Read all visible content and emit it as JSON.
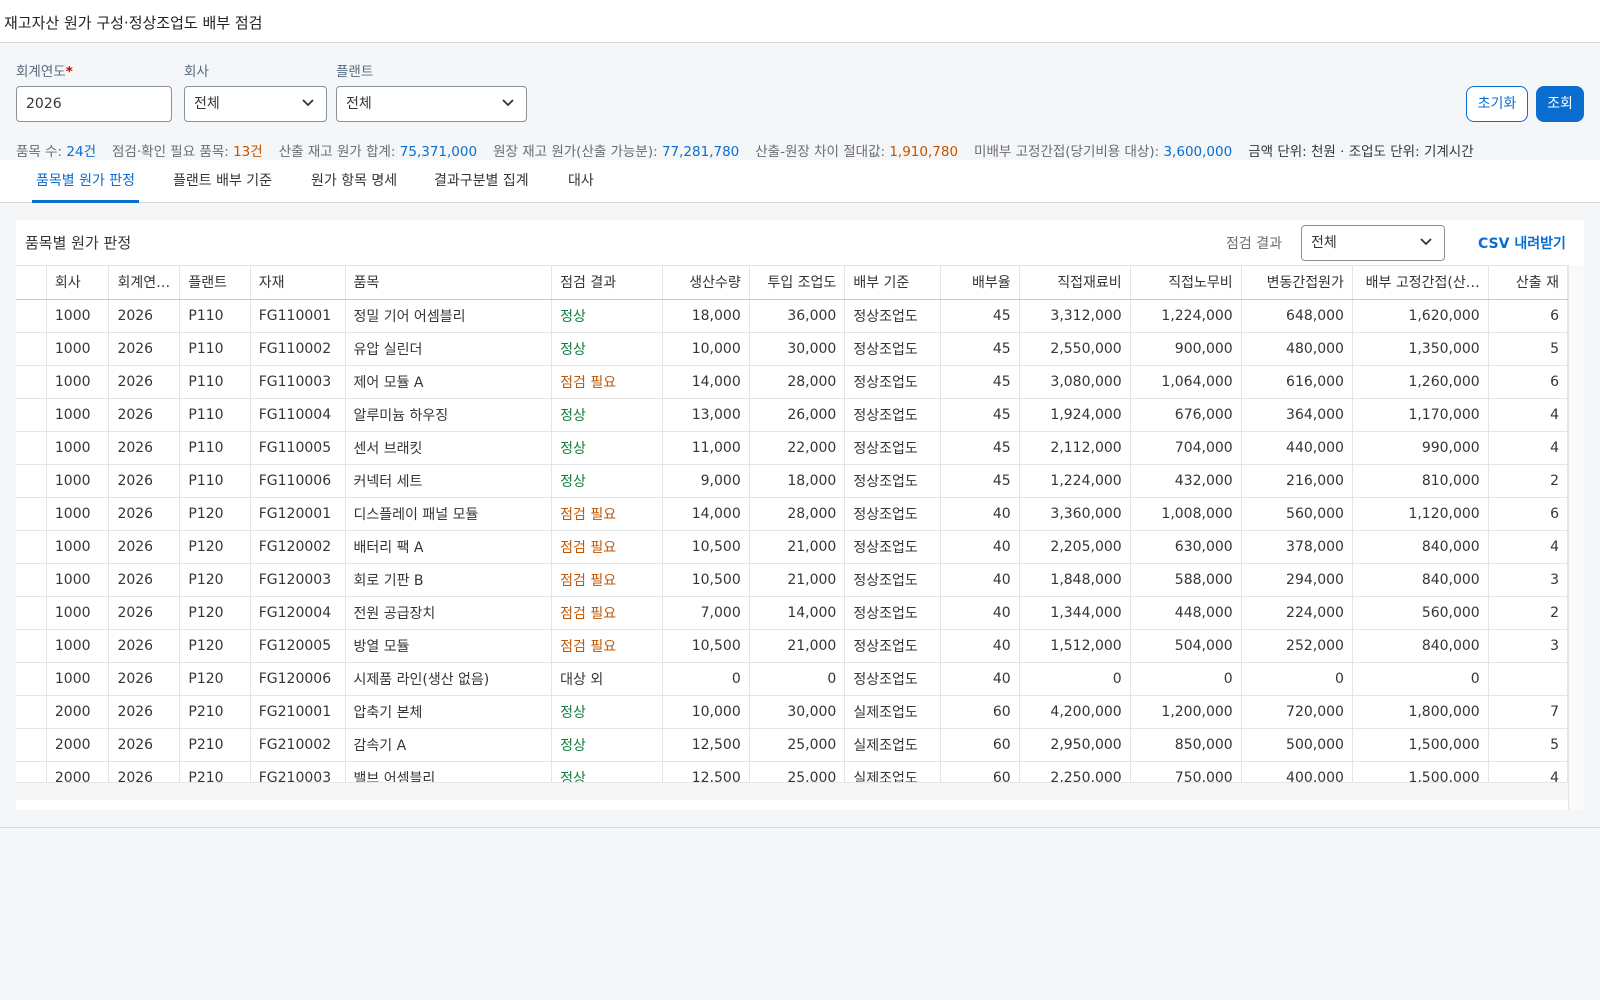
{
  "app": {
    "title": "재고자산 원가 구성·정상조업도 배부 점검"
  },
  "filters": {
    "year_label": "회계연도",
    "year_required": "*",
    "year_value": "2026",
    "company_label": "회사",
    "company_value": "전체",
    "plant_label": "플랜트",
    "plant_value": "전체",
    "reset_label": "초기화",
    "search_label": "조회"
  },
  "summary": {
    "items_label": "품목 수: ",
    "items_value": "24건",
    "check_label": "점검·확인 필요 품목: ",
    "check_value": "13건",
    "calc_label": "산출 재고 원가 합계: ",
    "calc_value": "75,371,000",
    "ledger_label": "원장 재고 원가(산출 가능분): ",
    "ledger_value": "77,281,780",
    "diff_label": "산출-원장 차이 절대값: ",
    "diff_value": "1,910,780",
    "unalloc_label": "미배부 고정간접(당기비용 대상): ",
    "unalloc_value": "3,600,000",
    "unit_text": "금액 단위: 천원 · 조업도 단위: 기계시간"
  },
  "tabs": [
    {
      "label": "품목별 원가 판정",
      "active": true
    },
    {
      "label": "플랜트 배부 기준",
      "active": false
    },
    {
      "label": "원가 항목 명세",
      "active": false
    },
    {
      "label": "결과구분별 집계",
      "active": false
    },
    {
      "label": "대사",
      "active": false
    }
  ],
  "panel": {
    "title": "품목별 원가 판정",
    "result_filter_label": "점검 결과",
    "result_filter_value": "전체",
    "csv_label": "CSV 내려받기"
  },
  "table": {
    "columns": [
      "회사",
      "회계연…",
      "플랜트",
      "자재",
      "품목",
      "점검 결과",
      "생산수량",
      "투입 조업도",
      "배부 기준",
      "배부율",
      "직접재료비",
      "직접노무비",
      "변동간접원가",
      "배부 고정간접(산…",
      "산출 재"
    ],
    "rows": [
      [
        "1000",
        "2026",
        "P110",
        "FG110001",
        "정밀 기어 어셈블리",
        "정상",
        "18,000",
        "36,000",
        "정상조업도",
        "45",
        "3,312,000",
        "1,224,000",
        "648,000",
        "1,620,000",
        "6"
      ],
      [
        "1000",
        "2026",
        "P110",
        "FG110002",
        "유압 실린더",
        "정상",
        "10,000",
        "30,000",
        "정상조업도",
        "45",
        "2,550,000",
        "900,000",
        "480,000",
        "1,350,000",
        "5"
      ],
      [
        "1000",
        "2026",
        "P110",
        "FG110003",
        "제어 모듈 A",
        "점검 필요",
        "14,000",
        "28,000",
        "정상조업도",
        "45",
        "3,080,000",
        "1,064,000",
        "616,000",
        "1,260,000",
        "6"
      ],
      [
        "1000",
        "2026",
        "P110",
        "FG110004",
        "알루미늄 하우징",
        "정상",
        "13,000",
        "26,000",
        "정상조업도",
        "45",
        "1,924,000",
        "676,000",
        "364,000",
        "1,170,000",
        "4"
      ],
      [
        "1000",
        "2026",
        "P110",
        "FG110005",
        "센서 브래킷",
        "정상",
        "11,000",
        "22,000",
        "정상조업도",
        "45",
        "2,112,000",
        "704,000",
        "440,000",
        "990,000",
        "4"
      ],
      [
        "1000",
        "2026",
        "P110",
        "FG110006",
        "커넥터 세트",
        "정상",
        "9,000",
        "18,000",
        "정상조업도",
        "45",
        "1,224,000",
        "432,000",
        "216,000",
        "810,000",
        "2"
      ],
      [
        "1000",
        "2026",
        "P120",
        "FG120001",
        "디스플레이 패널 모듈",
        "점검 필요",
        "14,000",
        "28,000",
        "정상조업도",
        "40",
        "3,360,000",
        "1,008,000",
        "560,000",
        "1,120,000",
        "6"
      ],
      [
        "1000",
        "2026",
        "P120",
        "FG120002",
        "배터리 팩 A",
        "점검 필요",
        "10,500",
        "21,000",
        "정상조업도",
        "40",
        "2,205,000",
        "630,000",
        "378,000",
        "840,000",
        "4"
      ],
      [
        "1000",
        "2026",
        "P120",
        "FG120003",
        "회로 기판 B",
        "점검 필요",
        "10,500",
        "21,000",
        "정상조업도",
        "40",
        "1,848,000",
        "588,000",
        "294,000",
        "840,000",
        "3"
      ],
      [
        "1000",
        "2026",
        "P120",
        "FG120004",
        "전원 공급장치",
        "점검 필요",
        "7,000",
        "14,000",
        "정상조업도",
        "40",
        "1,344,000",
        "448,000",
        "224,000",
        "560,000",
        "2"
      ],
      [
        "1000",
        "2026",
        "P120",
        "FG120005",
        "방열 모듈",
        "점검 필요",
        "10,500",
        "21,000",
        "정상조업도",
        "40",
        "1,512,000",
        "504,000",
        "252,000",
        "840,000",
        "3"
      ],
      [
        "1000",
        "2026",
        "P120",
        "FG120006",
        "시제품 라인(생산 없음)",
        "대상 외",
        "0",
        "0",
        "정상조업도",
        "40",
        "0",
        "0",
        "0",
        "0",
        ""
      ],
      [
        "2000",
        "2026",
        "P210",
        "FG210001",
        "압축기 본체",
        "정상",
        "10,000",
        "30,000",
        "실제조업도",
        "60",
        "4,200,000",
        "1,200,000",
        "720,000",
        "1,800,000",
        "7"
      ],
      [
        "2000",
        "2026",
        "P210",
        "FG210002",
        "감속기 A",
        "정상",
        "12,500",
        "25,000",
        "실제조업도",
        "60",
        "2,950,000",
        "850,000",
        "500,000",
        "1,500,000",
        "5"
      ],
      [
        "2000",
        "2026",
        "P210",
        "FG210003",
        "밸브 어셈블리",
        "정상",
        "12,500",
        "25,000",
        "실제조업도",
        "60",
        "2,250,000",
        "750,000",
        "400,000",
        "1,500,000",
        "4"
      ]
    ]
  },
  "status_colors": {
    "정상": "#107e3e",
    "점검 필요": "#c35500",
    "대상 외": "#32363a"
  },
  "icons": {
    "dropdown": "chevron-down-icon"
  }
}
